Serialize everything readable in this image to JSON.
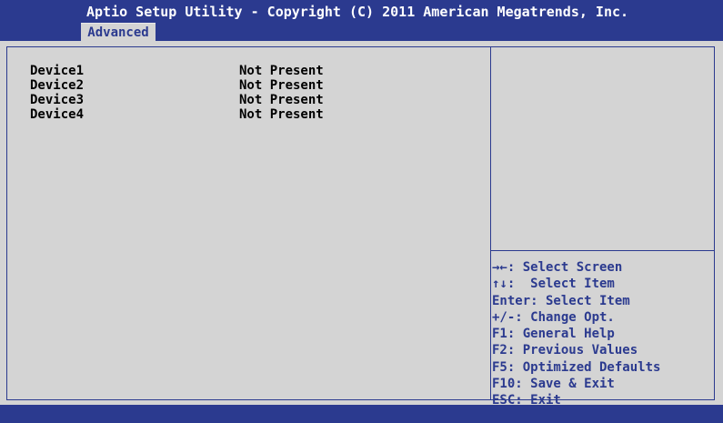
{
  "header": {
    "title": "Aptio Setup Utility - Copyright (C) 2011 American Megatrends, Inc.",
    "active_tab": "Advanced"
  },
  "devices": [
    {
      "name": "Device1",
      "status": "Not Present"
    },
    {
      "name": "Device2",
      "status": "Not Present"
    },
    {
      "name": "Device3",
      "status": "Not Present"
    },
    {
      "name": "Device4",
      "status": "Not Present"
    }
  ],
  "help": [
    "→←: Select Screen",
    "↑↓:  Select Item",
    "Enter: Select Item",
    "+/-: Change Opt.",
    "F1: General Help",
    "F2: Previous Values",
    "F5: Optimized Defaults",
    "F10: Save & Exit",
    "ESC: Exit"
  ],
  "colors": {
    "bios_blue": "#2b3a8f",
    "panel_gray": "#d4d4d4",
    "text_white": "#ffffff"
  }
}
